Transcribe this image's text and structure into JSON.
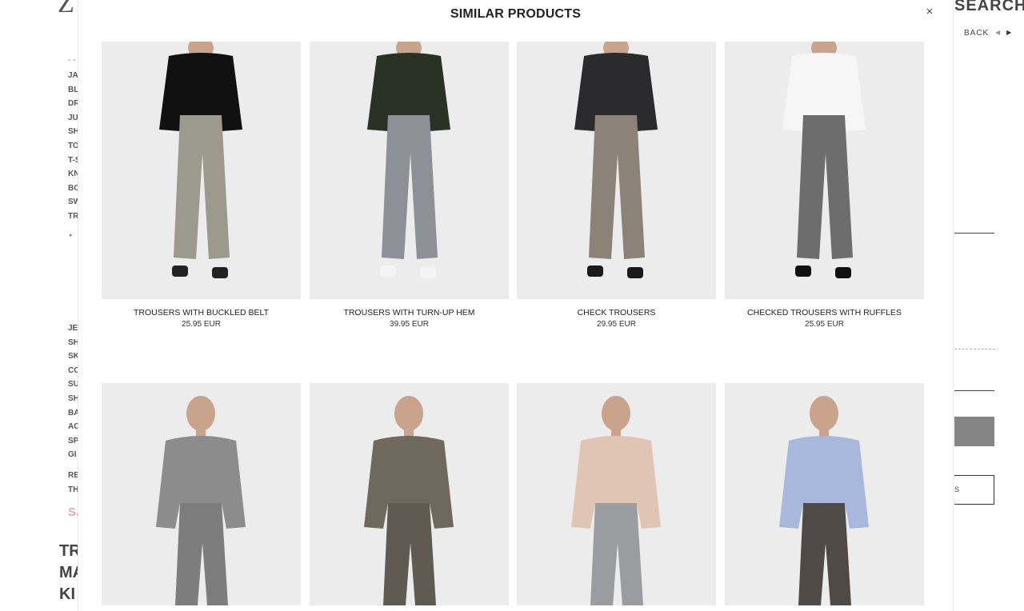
{
  "background": {
    "logo": "Z",
    "search_label": "SEARCH",
    "back_label": "BACK",
    "back_prev_icon": "triangle-left",
    "back_next_icon": "triangle-right",
    "sidebar_top": [
      "JA",
      "BL",
      "DR",
      "JU",
      "SH",
      "TO",
      "T-S",
      "KN",
      "BO",
      "SW",
      "TR"
    ],
    "sidebar_bottom": [
      "JE",
      "SH",
      "SK",
      "CO",
      "SU",
      "SH",
      "BA",
      "AC",
      "SP",
      "GI"
    ],
    "sidebar_extra": [
      "RE",
      "TH"
    ],
    "sale_label": "SA",
    "page_title_lines": [
      "TR",
      "MA",
      "KI"
    ],
    "outline_button_fragment": "S"
  },
  "modal": {
    "title": "SIMILAR PRODUCTS",
    "close_icon": "×",
    "products": [
      {
        "name": "TROUSERS WITH BUCKLED BELT",
        "price": "25.95 EUR",
        "top_color": "#111111",
        "bottom_color": "#9c9a8d",
        "shoe_color": "#222222"
      },
      {
        "name": "TROUSERS WITH TURN-UP HEM",
        "price": "39.95 EUR",
        "top_color": "#2a3225",
        "bottom_color": "#8e9098",
        "shoe_color": "#f4f4f4"
      },
      {
        "name": "CHECK TROUSERS",
        "price": "29.95 EUR",
        "top_color": "#2b2b2e",
        "bottom_color": "#8b8278",
        "shoe_color": "#1a1a1a"
      },
      {
        "name": "CHECKED TROUSERS WITH RUFFLES",
        "price": "25.95 EUR",
        "top_color": "#f6f6f6",
        "bottom_color": "#6d6d6d",
        "shoe_color": "#111111"
      },
      {
        "name": "",
        "price": "",
        "top_color": "#8c8c8c",
        "bottom_color": "#7d7d7d",
        "shoe_color": "#222222"
      },
      {
        "name": "",
        "price": "",
        "top_color": "#6e685d",
        "bottom_color": "#5f5a52",
        "shoe_color": "#222222"
      },
      {
        "name": "",
        "price": "",
        "top_color": "#e1c5b4",
        "bottom_color": "#9a9ca0",
        "shoe_color": "#222222"
      },
      {
        "name": "",
        "price": "",
        "top_color": "#a8b8dd",
        "bottom_color": "#4f4a46",
        "shoe_color": "#222222"
      }
    ]
  }
}
